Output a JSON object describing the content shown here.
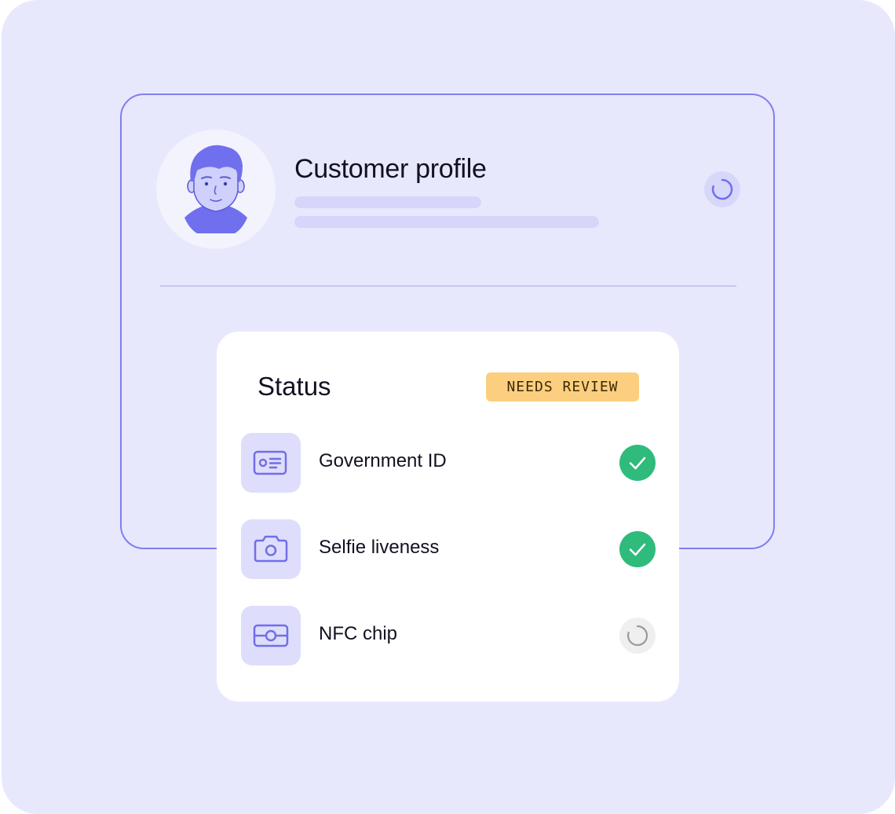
{
  "profile": {
    "title": "Customer profile",
    "avatar_icon": "person-avatar-icon",
    "state_icon": "loading-spinner-icon"
  },
  "status": {
    "title": "Status",
    "badge": "NEEDS REVIEW",
    "checks": [
      {
        "label": "Government ID",
        "icon": "id-card-icon",
        "state": "complete"
      },
      {
        "label": "Selfie liveness",
        "icon": "camera-icon",
        "state": "complete"
      },
      {
        "label": "NFC chip",
        "icon": "chip-card-icon",
        "state": "pending"
      }
    ]
  },
  "colors": {
    "accent": "#7f7ff0",
    "background": "#e8e8fd",
    "success": "#2fbb7c",
    "warning": "#fccf80"
  }
}
